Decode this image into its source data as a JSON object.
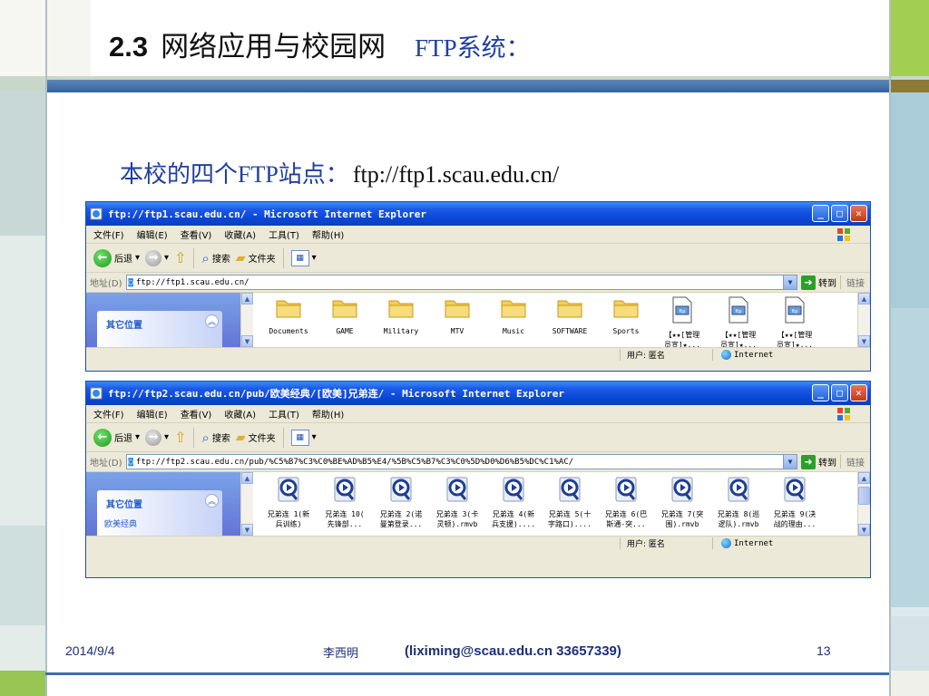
{
  "slide": {
    "title_num": "2.3",
    "title_text": "网络应用与校园网",
    "title_sub": "FTP系统：",
    "heading_text": "本校的四个FTP站点：",
    "heading_url": "ftp://ftp1.scau.edu.cn/",
    "footer_date": "2014/9/4",
    "footer_author": "李西明",
    "footer_contact": "(liximing@scau.edu.cn  33657339)",
    "footer_page": "13"
  },
  "windows": [
    {
      "title": "ftp://ftp1.scau.edu.cn/ - Microsoft Internet Explorer",
      "menu": [
        "文件(F)",
        "编辑(E)",
        "查看(V)",
        "收藏(A)",
        "工具(T)",
        "帮助(H)"
      ],
      "toolbar": {
        "back": "后退",
        "search": "搜索",
        "folders": "文件夹"
      },
      "address_label": "地址(D)",
      "address": "ftp://ftp1.scau.edu.cn/",
      "go": "转到",
      "links": "链接",
      "pane_title": "其它位置",
      "pane_item": "",
      "files": [
        {
          "name": "Documents",
          "kind": "folder"
        },
        {
          "name": "GAME",
          "kind": "folder"
        },
        {
          "name": "Military",
          "kind": "folder"
        },
        {
          "name": "MTV",
          "kind": "folder"
        },
        {
          "name": "Music",
          "kind": "folder"
        },
        {
          "name": "SOFTWARE",
          "kind": "folder"
        },
        {
          "name": "Sports",
          "kind": "folder"
        },
        {
          "name": "【★★[管理\n员宣]★...",
          "kind": "doc"
        },
        {
          "name": "【★★[管理\n员宣]★...",
          "kind": "doc"
        },
        {
          "name": "【★★[管理\n员宣]★...",
          "kind": "doc"
        }
      ],
      "status_user": "用户: 匿名",
      "status_zone": "Internet"
    },
    {
      "title": "ftp://ftp2.scau.edu.cn/pub/欧美经典/[欧美]兄弟连/ - Microsoft Internet Explorer",
      "menu": [
        "文件(F)",
        "编辑(E)",
        "查看(V)",
        "收藏(A)",
        "工具(T)",
        "帮助(H)"
      ],
      "toolbar": {
        "back": "后退",
        "search": "搜索",
        "folders": "文件夹"
      },
      "address_label": "地址(D)",
      "address": "ftp://ftp2.scau.edu.cn/pub/%C5%B7%C3%C0%BE%AD%B5%E4/%5B%C5%B7%C3%C0%5D%D0%D6%B5%DC%C1%AC/",
      "go": "转到",
      "links": "链接",
      "pane_title": "其它位置",
      "pane_item": "欧美经典",
      "files": [
        {
          "name": "兄弟连 1(新\n兵训练)",
          "kind": "media"
        },
        {
          "name": "兄弟连 10(\n先锋部...",
          "kind": "media"
        },
        {
          "name": "兄弟连 2(诺\n曼第登录...",
          "kind": "media"
        },
        {
          "name": "兄弟连 3(卡\n灵顿).rmvb",
          "kind": "media"
        },
        {
          "name": "兄弟连 4(新\n兵支援)....",
          "kind": "media"
        },
        {
          "name": "兄弟连 5(十\n字路口)....",
          "kind": "media"
        },
        {
          "name": "兄弟连 6(巴\n斯通-突...",
          "kind": "media"
        },
        {
          "name": "兄弟连 7(突\n围).rmvb",
          "kind": "media"
        },
        {
          "name": "兄弟连 8(巡\n逻队).rmvb",
          "kind": "media"
        },
        {
          "name": "兄弟连 9(决\n战的理由...",
          "kind": "media"
        }
      ],
      "status_user": "用户: 匿名",
      "status_zone": "Internet"
    }
  ],
  "colors": {
    "title_blue": "#1f3fa0",
    "xp_blue": "#0a46d8",
    "accent_green": "#98c654"
  }
}
